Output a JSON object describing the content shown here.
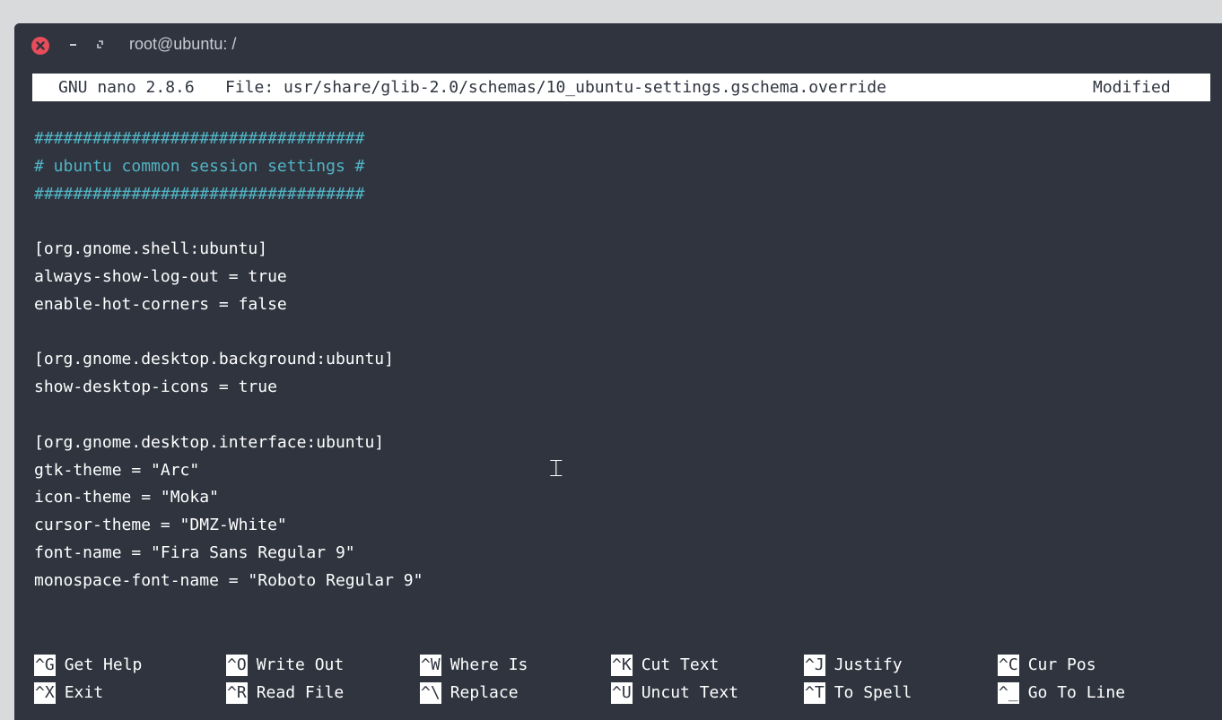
{
  "window": {
    "title": "root@ubuntu: /",
    "controls": {
      "close": "close-icon",
      "minimize": "minimize-icon",
      "maximize": "maximize-icon"
    },
    "close_color": "#e74c5b"
  },
  "nano_header": {
    "version": "GNU nano 2.8.6",
    "file": "File: usr/share/glib-2.0/schemas/10_ubuntu-settings.gschema.override",
    "status": "Modified"
  },
  "editor": {
    "comment_color": "#52b4c4",
    "lines": [
      "##################################",
      "# ubuntu common session settings #",
      "##################################",
      "",
      "[org.gnome.shell:ubuntu]",
      "always-show-log-out = true",
      "enable-hot-corners = false",
      "",
      "[org.gnome.desktop.background:ubuntu]",
      "show-desktop-icons = true",
      "",
      "[org.gnome.desktop.interface:ubuntu]",
      "gtk-theme = \"Arc\"",
      "icon-theme = \"Moka\"",
      "cursor-theme = \"DMZ-White\"",
      "font-name = \"Fira Sans Regular 9\"",
      "monospace-font-name = \"Roboto Regular 9\""
    ]
  },
  "shortcuts": [
    {
      "key": "^G",
      "label": "Get Help"
    },
    {
      "key": "^O",
      "label": "Write Out"
    },
    {
      "key": "^W",
      "label": "Where Is"
    },
    {
      "key": "^K",
      "label": "Cut Text"
    },
    {
      "key": "^J",
      "label": "Justify"
    },
    {
      "key": "^C",
      "label": "Cur Pos"
    },
    {
      "key": "^X",
      "label": "Exit"
    },
    {
      "key": "^R",
      "label": "Read File"
    },
    {
      "key": "^\\",
      "label": "Replace"
    },
    {
      "key": "^U",
      "label": "Uncut Text"
    },
    {
      "key": "^T",
      "label": "To Spell"
    },
    {
      "key": "^_",
      "label": "Go To Line"
    }
  ],
  "cursor": "ibeam-cursor-icon"
}
